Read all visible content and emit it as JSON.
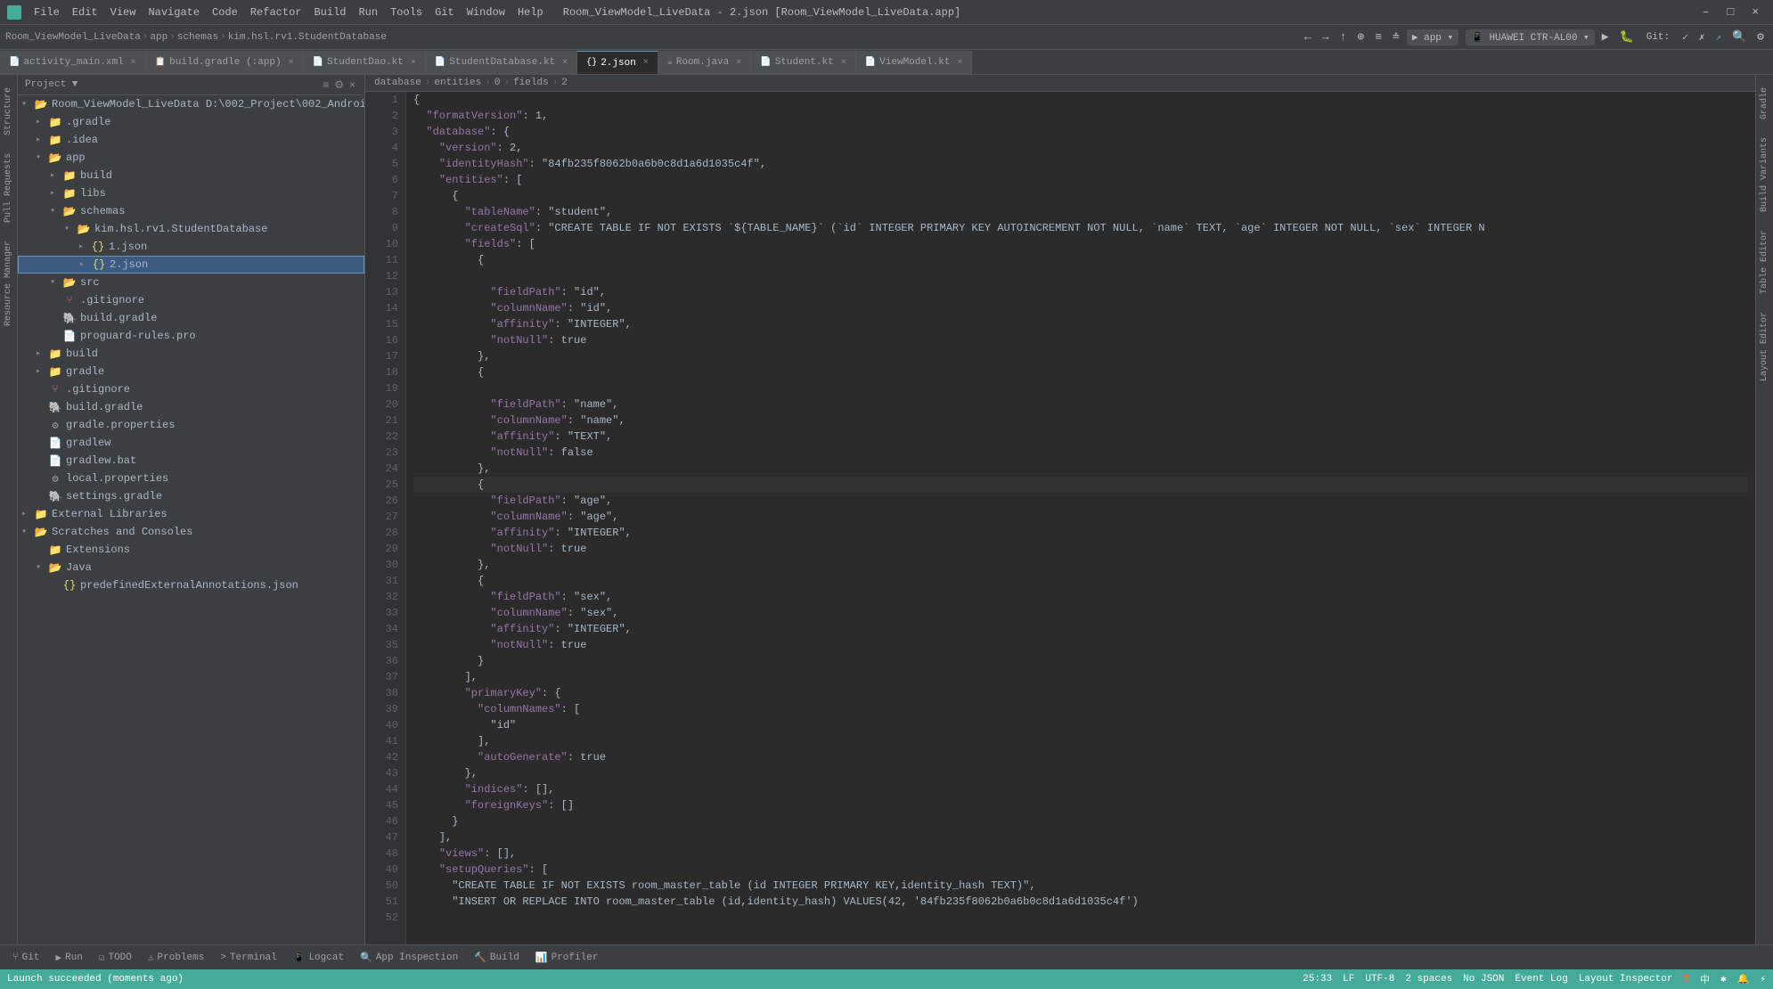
{
  "titleBar": {
    "icon": "🟩",
    "menuItems": [
      "File",
      "Edit",
      "View",
      "Navigate",
      "Code",
      "Refactor",
      "Build",
      "Run",
      "Tools",
      "Git",
      "Window",
      "Help"
    ],
    "title": "Room_ViewModel_LiveData - 2.json [Room_ViewModel_LiveData.app]",
    "winControls": [
      "–",
      "□",
      "×"
    ]
  },
  "navBar": {
    "breadcrumb": [
      "Room_ViewModel_LiveData",
      "app",
      "schemas",
      "kim.hsl.rv1.StudentDatabase"
    ],
    "buttons": [
      "←",
      "→",
      "↑",
      "⊕",
      "≡",
      "≐"
    ]
  },
  "tabs": [
    {
      "label": "activity_main.xml",
      "icon": "📄",
      "active": false
    },
    {
      "label": "build.gradle (:app)",
      "icon": "📋",
      "active": false
    },
    {
      "label": "StudentDao.kt",
      "icon": "📄",
      "active": false
    },
    {
      "label": "StudentDatabase.kt",
      "icon": "📄",
      "active": false
    },
    {
      "label": "2.json",
      "icon": "{}",
      "active": true
    },
    {
      "label": "Room.java",
      "icon": "☕",
      "active": false
    },
    {
      "label": "Student.kt",
      "icon": "📄",
      "active": false
    },
    {
      "label": "ViewModel.kt",
      "icon": "📄",
      "active": false
    }
  ],
  "fileTree": {
    "header": "Project ▼",
    "items": [
      {
        "label": "Room_ViewModel_LiveData D:\\002_Project\\002_Android_Learn\\Room_",
        "icon": "folder-open",
        "indent": 0,
        "expanded": true
      },
      {
        "label": ".gradle",
        "icon": "folder",
        "indent": 1,
        "expanded": false
      },
      {
        "label": ".idea",
        "icon": "folder",
        "indent": 1,
        "expanded": false
      },
      {
        "label": "app",
        "icon": "folder-open",
        "indent": 1,
        "expanded": true
      },
      {
        "label": "build",
        "icon": "folder",
        "indent": 2,
        "expanded": false
      },
      {
        "label": "libs",
        "icon": "folder",
        "indent": 2,
        "expanded": false
      },
      {
        "label": "schemas",
        "icon": "folder-open",
        "indent": 2,
        "expanded": true
      },
      {
        "label": "kim.hsl.rv1.StudentDatabase",
        "icon": "folder-open",
        "indent": 3,
        "expanded": true
      },
      {
        "label": "1.json",
        "icon": "json",
        "indent": 4,
        "expanded": false
      },
      {
        "label": "2.json",
        "icon": "json",
        "indent": 4,
        "expanded": false,
        "selected": true,
        "highlighted": true
      },
      {
        "label": "src",
        "icon": "folder-open",
        "indent": 2,
        "expanded": true
      },
      {
        "label": ".gitignore",
        "icon": "git",
        "indent": 2
      },
      {
        "label": "build.gradle",
        "icon": "gradle",
        "indent": 2
      },
      {
        "label": "proguard-rules.pro",
        "icon": "file",
        "indent": 2
      },
      {
        "label": "build",
        "icon": "folder",
        "indent": 1,
        "expanded": false
      },
      {
        "label": "gradle",
        "icon": "folder",
        "indent": 1,
        "expanded": false
      },
      {
        "label": ".gitignore",
        "icon": "git",
        "indent": 1
      },
      {
        "label": "build.gradle",
        "icon": "gradle",
        "indent": 1
      },
      {
        "label": "gradle.properties",
        "icon": "props",
        "indent": 1
      },
      {
        "label": "gradlew",
        "icon": "file",
        "indent": 1
      },
      {
        "label": "gradlew.bat",
        "icon": "file",
        "indent": 1
      },
      {
        "label": "local.properties",
        "icon": "props",
        "indent": 1
      },
      {
        "label": "settings.gradle",
        "icon": "gradle",
        "indent": 1
      },
      {
        "label": "External Libraries",
        "icon": "folder",
        "indent": 0,
        "expanded": false
      },
      {
        "label": "Scratches and Consoles",
        "icon": "folder-open",
        "indent": 0,
        "expanded": true
      },
      {
        "label": "Extensions",
        "icon": "folder",
        "indent": 1
      },
      {
        "label": "Java",
        "icon": "folder-open",
        "indent": 1,
        "expanded": true
      },
      {
        "label": "predefinedExternalAnnotations.json",
        "icon": "json",
        "indent": 2
      }
    ]
  },
  "editorPath": {
    "segments": [
      "database",
      "entities",
      "0",
      "fields",
      "2"
    ]
  },
  "codeLines": [
    {
      "num": 1,
      "text": "{"
    },
    {
      "num": 2,
      "text": "  \"formatVersion\": 1,"
    },
    {
      "num": 3,
      "text": "  \"database\": {"
    },
    {
      "num": 4,
      "text": "    \"version\": 2,"
    },
    {
      "num": 5,
      "text": "    \"identityHash\": \"84fb235f8062b0a6b0c8d1a6d1035c4f\","
    },
    {
      "num": 6,
      "text": "    \"entities\": ["
    },
    {
      "num": 7,
      "text": "      {"
    },
    {
      "num": 8,
      "text": "        \"tableName\": \"student\","
    },
    {
      "num": 9,
      "text": "        \"createSql\": \"CREATE TABLE IF NOT EXISTS `${TABLE_NAME}` (`id` INTEGER PRIMARY KEY AUTOINCREMENT NOT NULL, `name` TEXT, `age` INTEGER NOT NULL, `sex` INTEGER N"
    },
    {
      "num": 10,
      "text": "        \"fields\": ["
    },
    {
      "num": 11,
      "text": "          {"
    },
    {
      "num": 12,
      "text": ""
    },
    {
      "num": 13,
      "text": "            \"fieldPath\": \"id\","
    },
    {
      "num": 14,
      "text": "            \"columnName\": \"id\","
    },
    {
      "num": 15,
      "text": "            \"affinity\": \"INTEGER\","
    },
    {
      "num": 16,
      "text": "            \"notNull\": true"
    },
    {
      "num": 17,
      "text": "          },"
    },
    {
      "num": 18,
      "text": "          {"
    },
    {
      "num": 19,
      "text": ""
    },
    {
      "num": 20,
      "text": "            \"fieldPath\": \"name\","
    },
    {
      "num": 21,
      "text": "            \"columnName\": \"name\","
    },
    {
      "num": 22,
      "text": "            \"affinity\": \"TEXT\","
    },
    {
      "num": 23,
      "text": "            \"notNull\": false"
    },
    {
      "num": 24,
      "text": "          },"
    },
    {
      "num": 25,
      "text": "          {",
      "active": true
    },
    {
      "num": 26,
      "text": "            \"fieldPath\": \"age\","
    },
    {
      "num": 27,
      "text": "            \"columnName\": \"age\","
    },
    {
      "num": 28,
      "text": "            \"affinity\": \"INTEGER\","
    },
    {
      "num": 29,
      "text": "            \"notNull\": true"
    },
    {
      "num": 30,
      "text": "          },"
    },
    {
      "num": 31,
      "text": "          {"
    },
    {
      "num": 32,
      "text": "            \"fieldPath\": \"sex\","
    },
    {
      "num": 33,
      "text": "            \"columnName\": \"sex\","
    },
    {
      "num": 34,
      "text": "            \"affinity\": \"INTEGER\","
    },
    {
      "num": 35,
      "text": "            \"notNull\": true"
    },
    {
      "num": 36,
      "text": "          }"
    },
    {
      "num": 37,
      "text": "        ],"
    },
    {
      "num": 38,
      "text": "        \"primaryKey\": {"
    },
    {
      "num": 39,
      "text": "          \"columnNames\": ["
    },
    {
      "num": 40,
      "text": "            \"id\""
    },
    {
      "num": 41,
      "text": "          ],"
    },
    {
      "num": 42,
      "text": "          \"autoGenerate\": true"
    },
    {
      "num": 43,
      "text": "        },"
    },
    {
      "num": 44,
      "text": "        \"indices\": [],"
    },
    {
      "num": 45,
      "text": "        \"foreignKeys\": []"
    },
    {
      "num": 46,
      "text": "      }"
    },
    {
      "num": 47,
      "text": "    ],"
    },
    {
      "num": 48,
      "text": "    \"views\": [],"
    },
    {
      "num": 49,
      "text": "    \"setupQueries\": ["
    },
    {
      "num": 50,
      "text": "      \"CREATE TABLE IF NOT EXISTS room_master_table (id INTEGER PRIMARY KEY,identity_hash TEXT)\","
    },
    {
      "num": 51,
      "text": "      \"INSERT OR REPLACE INTO room_master_table (id,identity_hash) VALUES(42, '84fb235f8062b0a6b0c8d1a6d1035c4f')"
    },
    {
      "num": 52,
      "text": ""
    }
  ],
  "bottomTabs": [
    {
      "label": "Git",
      "icon": "⑂"
    },
    {
      "label": "Run",
      "icon": "▶"
    },
    {
      "label": "TODO",
      "icon": "☑"
    },
    {
      "label": "Problems",
      "icon": "⚠"
    },
    {
      "label": "Terminal",
      "icon": ">"
    },
    {
      "label": "Logcat",
      "icon": "📱"
    },
    {
      "label": "App Inspection",
      "icon": "🔍"
    },
    {
      "label": "Build",
      "icon": "🔨"
    },
    {
      "label": "Profiler",
      "icon": "📊"
    }
  ],
  "statusBar": {
    "message": "Launch succeeded (moments ago)",
    "position": "25:33",
    "encoding": "LF",
    "charset": "UTF-8",
    "indent": "2 spaces",
    "format": "No JSON",
    "rightItems": [
      "Event Log",
      "Layout Inspector"
    ],
    "logo": "S"
  },
  "rightPanels": [
    "Gradle",
    "Build Variants"
  ],
  "leftPanels": [
    "Structure",
    "Pull Requests",
    "Resource Manager"
  ],
  "colors": {
    "active": "#4a9",
    "accent": "#6897bb",
    "background": "#2b2b2b",
    "sidebar": "#3c3f41",
    "selection": "#214283"
  }
}
